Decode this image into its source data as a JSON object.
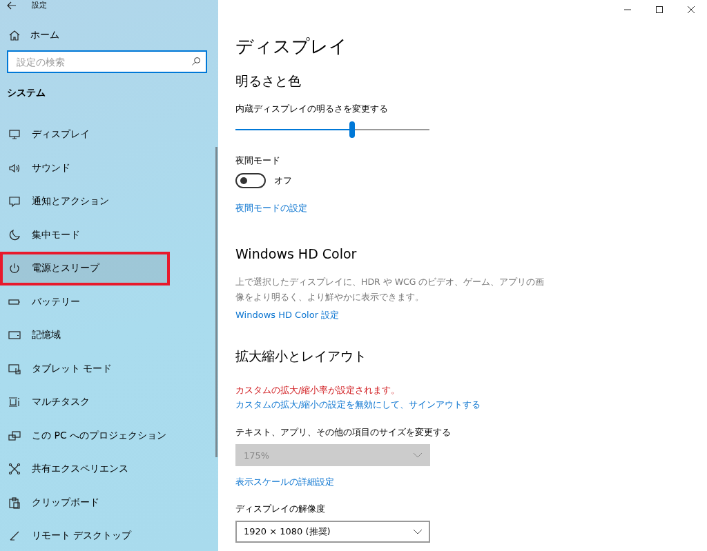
{
  "window": {
    "title": "設定"
  },
  "sidebar": {
    "home": "ホーム",
    "search": {
      "placeholder": "設定の検索"
    },
    "section": "システム",
    "items": [
      {
        "label": "ディスプレイ",
        "selected": false,
        "highlighted": false
      },
      {
        "label": "サウンド",
        "selected": false,
        "highlighted": false
      },
      {
        "label": "通知とアクション",
        "selected": false,
        "highlighted": false
      },
      {
        "label": "集中モード",
        "selected": false,
        "highlighted": false
      },
      {
        "label": "電源とスリープ",
        "selected": true,
        "highlighted": true
      },
      {
        "label": "バッテリー",
        "selected": false,
        "highlighted": false
      },
      {
        "label": "記憶域",
        "selected": false,
        "highlighted": false
      },
      {
        "label": "タブレット モード",
        "selected": false,
        "highlighted": false
      },
      {
        "label": "マルチタスク",
        "selected": false,
        "highlighted": false
      },
      {
        "label": "この PC へのプロジェクション",
        "selected": false,
        "highlighted": false
      },
      {
        "label": "共有エクスペリエンス",
        "selected": false,
        "highlighted": false
      },
      {
        "label": "クリップボード",
        "selected": false,
        "highlighted": false
      },
      {
        "label": "リモート デスクトップ",
        "selected": false,
        "highlighted": false
      }
    ]
  },
  "content": {
    "title": "ディスプレイ",
    "brightness": {
      "heading": "明るさと色",
      "label": "内蔵ディスプレイの明るさを変更する",
      "level": 0.6
    },
    "night": {
      "label": "夜間モード",
      "on": false,
      "state": "オフ",
      "link": "夜間モードの設定"
    },
    "hdr": {
      "heading": "Windows HD Color",
      "description": "上で選択したディスプレイに、HDR や WCG のビデオ、ゲーム、アプリの画像をより明るく、より鮮やかに表示できます。",
      "link": "Windows HD Color 設定"
    },
    "scale": {
      "heading": "拡大縮小とレイアウト",
      "warning": "カスタムの拡大/縮小率が設定されます。",
      "warning_link": "カスタムの拡大/縮小の設定を無効にして、サインアウトする",
      "size_label": "テキスト、アプリ、その他の項目のサイズを変更する",
      "size_value": "175%",
      "size_disabled": true,
      "advanced_link": "表示スケールの詳細設定",
      "resolution_label": "ディスプレイの解像度",
      "resolution_value": "1920 × 1080 (推奨)",
      "resolution_disabled": false
    }
  }
}
